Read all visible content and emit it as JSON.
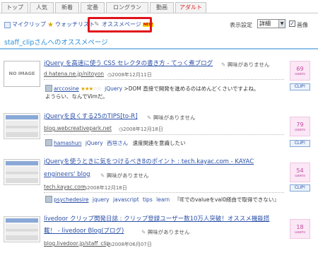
{
  "tabs": [
    "トップ",
    "人気",
    "新着",
    "定番",
    "ロングラン",
    "動画",
    "アダルト"
  ],
  "subnav": {
    "myclip": "マイクリップ",
    "watchlist": "ウォッチリスト",
    "recommend": "オススメページ",
    "new_badge": "NEW"
  },
  "display": {
    "label": "表示設定",
    "selected": "詳細",
    "image_checked": "✓",
    "image_label": "画像"
  },
  "heading": "staff_clipさんへのオススメページ",
  "no_image": "NO IMAGE",
  "interest_label": "興味がありません",
  "clip_label": "CLIP!",
  "users_label": "users",
  "entries": [
    {
      "title": "jQuery を高速に使う CSS セレクタの書き方 - てっく煮ブログ",
      "domain": "d.hatena.ne.jp/nitoyon",
      "date": "2008年12月11日",
      "users": "69",
      "comment_user": "arccosine",
      "rating": 3,
      "comment_tag": "jQuery",
      "comment_text": ">DOM 直接で開発を進めるのはめんどくさいですよね。",
      "comment_text2": "ようらい、なんでVimだ。"
    },
    {
      "title": "jQueryを良くする25のTIPS[to-R]",
      "domain": "blog.webcreativepark.net",
      "date": "2008年12月18日",
      "users": "79",
      "comment_user": "hamashun",
      "comment_tag": "jQuery",
      "comment_tag2": "西垣さん",
      "comment_text": "速度関連を意識したい"
    },
    {
      "title": "jQueryを使うときに気をつけるべき8のポイント : tech.kayac.com - KAYAC",
      "title2": "engineers' blog",
      "domain": "tech.kayac.com",
      "date": "2008年12月18日",
      "users": "54",
      "comment_user": "psychedesire",
      "comment_tags": [
        "jquery",
        "javascript",
        "tips",
        "learn"
      ],
      "comment_text": "『IEでのvalueをval0経由で取得できない』"
    },
    {
      "title": "livedoor クリップ開発日誌 : クリップ登録ユーザー数10万人突破！オススメ機能搭",
      "title2": "載！ - livedoor Blog(ブログ)",
      "domain": "blog.livedoor.jp/staff_clip",
      "date": "2008年06月07日",
      "users": "18"
    }
  ]
}
